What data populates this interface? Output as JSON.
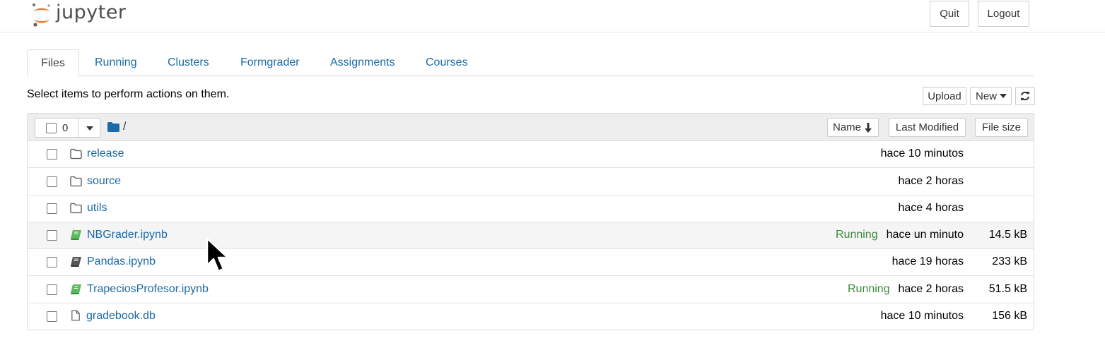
{
  "header": {
    "logo_text": "jupyter",
    "quit_label": "Quit",
    "logout_label": "Logout"
  },
  "tabs": [
    {
      "label": "Files",
      "active": true
    },
    {
      "label": "Running"
    },
    {
      "label": "Clusters"
    },
    {
      "label": "Formgrader"
    },
    {
      "label": "Assignments"
    },
    {
      "label": "Courses"
    }
  ],
  "toolbar": {
    "hint": "Select items to perform actions on them.",
    "upload_label": "Upload",
    "new_label": "New",
    "refresh_icon": "refresh-icon"
  },
  "list_header": {
    "selected_count": "0",
    "path": "/",
    "sort_name_label": "Name",
    "sort_modified_label": "Last Modified",
    "sort_size_label": "File size"
  },
  "colors": {
    "link": "#1b6aa5",
    "running": "#3c8a3c",
    "notebook_running_icon": "#5cb85c",
    "notebook_icon": "#555555",
    "jupyter_orange": "#f37726"
  },
  "files": [
    {
      "name": "release",
      "type": "folder",
      "modified": "hace 10 minutos",
      "size": "",
      "status": ""
    },
    {
      "name": "source",
      "type": "folder",
      "modified": "hace 2 horas",
      "size": "",
      "status": ""
    },
    {
      "name": "utils",
      "type": "folder",
      "modified": "hace 4 horas",
      "size": "",
      "status": ""
    },
    {
      "name": "NBGrader.ipynb",
      "type": "notebook-running",
      "modified": "hace un minuto",
      "size": "14.5 kB",
      "status": "Running"
    },
    {
      "name": "Pandas.ipynb",
      "type": "notebook",
      "modified": "hace 19 horas",
      "size": "233 kB",
      "status": ""
    },
    {
      "name": "TrapeciosProfesor.ipynb",
      "type": "notebook-running",
      "modified": "hace 2 horas",
      "size": "51.5 kB",
      "status": "Running"
    },
    {
      "name": "gradebook.db",
      "type": "file",
      "modified": "hace 10 minutos",
      "size": "156 kB",
      "status": ""
    }
  ]
}
